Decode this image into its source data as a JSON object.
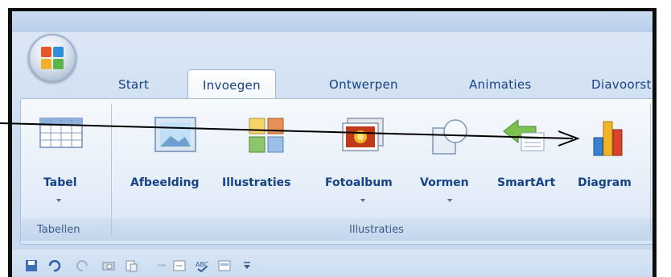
{
  "tabs": [
    {
      "label": "Start",
      "active": false
    },
    {
      "label": "Invoegen",
      "active": true
    },
    {
      "label": "Ontwerpen",
      "active": false
    },
    {
      "label": "Animaties",
      "active": false
    },
    {
      "label": "Diavoorst",
      "active": false
    }
  ],
  "ribbon": {
    "items": [
      {
        "label": "Tabel",
        "icon": "table-icon",
        "has_dropdown": true
      },
      {
        "label": "Afbeelding",
        "icon": "picture-icon",
        "has_dropdown": false
      },
      {
        "label": "Illustraties",
        "icon": "clipart-icon",
        "has_dropdown": false
      },
      {
        "label": "Fotoalbum",
        "icon": "photo-album-icon",
        "has_dropdown": true
      },
      {
        "label": "Vormen",
        "icon": "shapes-icon",
        "has_dropdown": true
      },
      {
        "label": "SmartArt",
        "icon": "smartart-icon",
        "has_dropdown": false
      },
      {
        "label": "Diagram",
        "icon": "chart-icon",
        "has_dropdown": false
      }
    ],
    "groups": [
      {
        "label": "Tabellen"
      },
      {
        "label": "Illustraties"
      }
    ]
  },
  "annotation": {
    "arrow_target": "Diagram"
  },
  "colors": {
    "tab_text": "#15428b",
    "ribbon_bg": "#e7eff9",
    "frame": "#0d0d0d"
  }
}
